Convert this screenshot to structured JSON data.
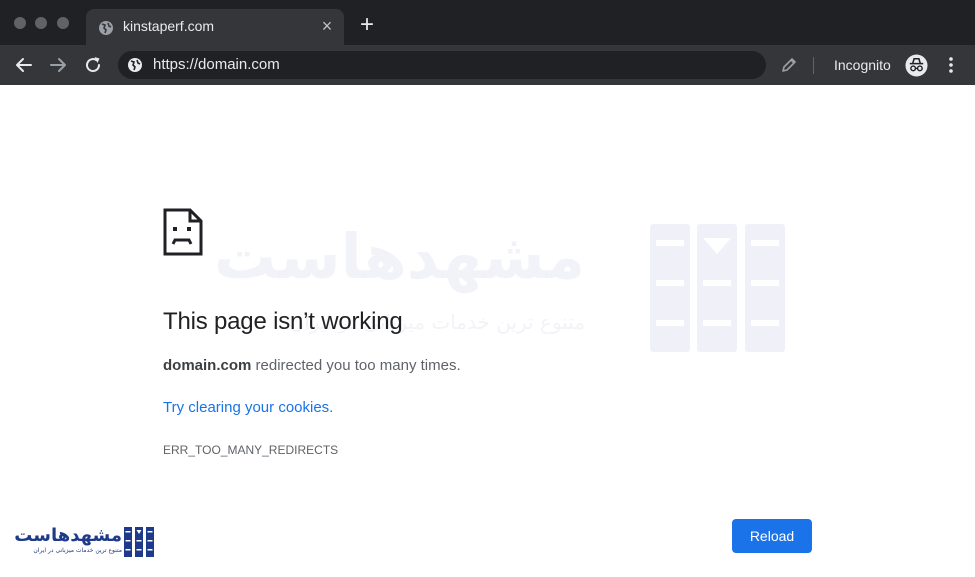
{
  "browser": {
    "tab": {
      "title": "kinstaperf.com",
      "close_glyph": "×",
      "favicon": "globe-icon"
    },
    "new_tab_glyph": "+",
    "omnibox": {
      "url": "https://domain.com",
      "icon": "globe-icon"
    },
    "incognito_label": "Incognito",
    "colors": {
      "frame": "#202124",
      "toolbar": "#35363a",
      "text": "#e8eaed",
      "icon": "#9aa0a6"
    }
  },
  "error": {
    "icon": "sad-document-icon",
    "title": "This page isn’t working",
    "domain": "domain.com",
    "message_rest": " redirected you too many times.",
    "link": "Try clearing your cookies.",
    "code": "ERR_TOO_MANY_REDIRECTS",
    "reload_label": "Reload",
    "colors": {
      "link": "#1a73e8",
      "button": "#1a73e8"
    }
  },
  "watermark": {
    "text": "مشهدهاست",
    "subtitle": "متنوع ترین خدمات میزبانی در ایران"
  },
  "brand": {
    "text": "مشهدهاست",
    "subtitle": "متنوع ترین خدمات میزبانی در ایران",
    "color": "#1e3a8a"
  }
}
